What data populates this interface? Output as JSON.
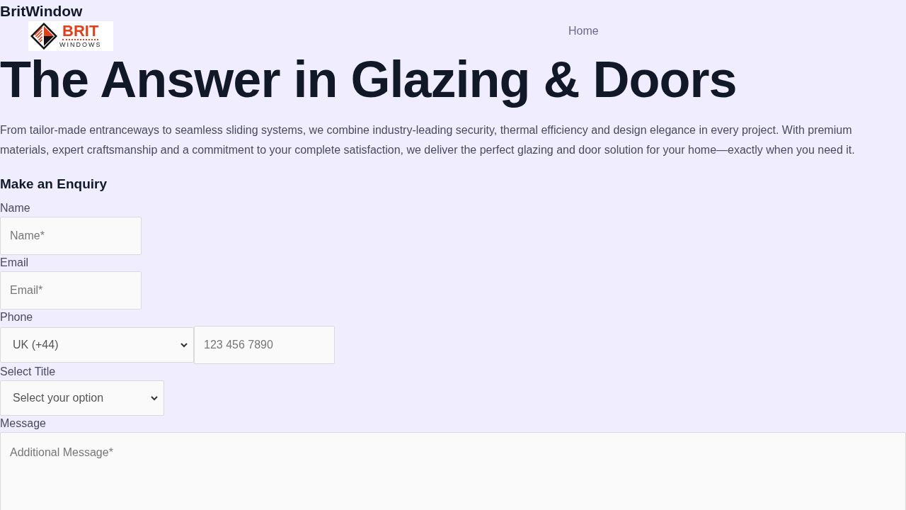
{
  "site_name": "BritWindow",
  "logo": {
    "word": "BRIT",
    "subword": "WINDOWS"
  },
  "nav": [
    {
      "label": "Home"
    }
  ],
  "hero": {
    "title": "The Answer in Glazing & Doors",
    "text": "From tailor-made entranceways to seamless sliding systems, we combine industry-leading security, thermal efficiency and design elegance in every project. With premium materials, expert craftsmanship and a commitment to your complete satisfaction, we deliver the perfect glazing and door solution for your home—exactly when you need it."
  },
  "form": {
    "title": "Make an Enquiry",
    "fields": [
      {
        "kind": "input",
        "label": "Name",
        "placeholder": "Name*"
      },
      {
        "kind": "input",
        "label": "Email",
        "placeholder": "Email*"
      },
      {
        "kind": "phone",
        "label": "Phone",
        "value": "UK (+44)",
        "placeholder": "123 456 7890"
      },
      {
        "kind": "select",
        "label": "Select Title",
        "value": "Select your option"
      },
      {
        "kind": "textarea",
        "label": "Message",
        "placeholder": "Additional Message*"
      }
    ]
  }
}
